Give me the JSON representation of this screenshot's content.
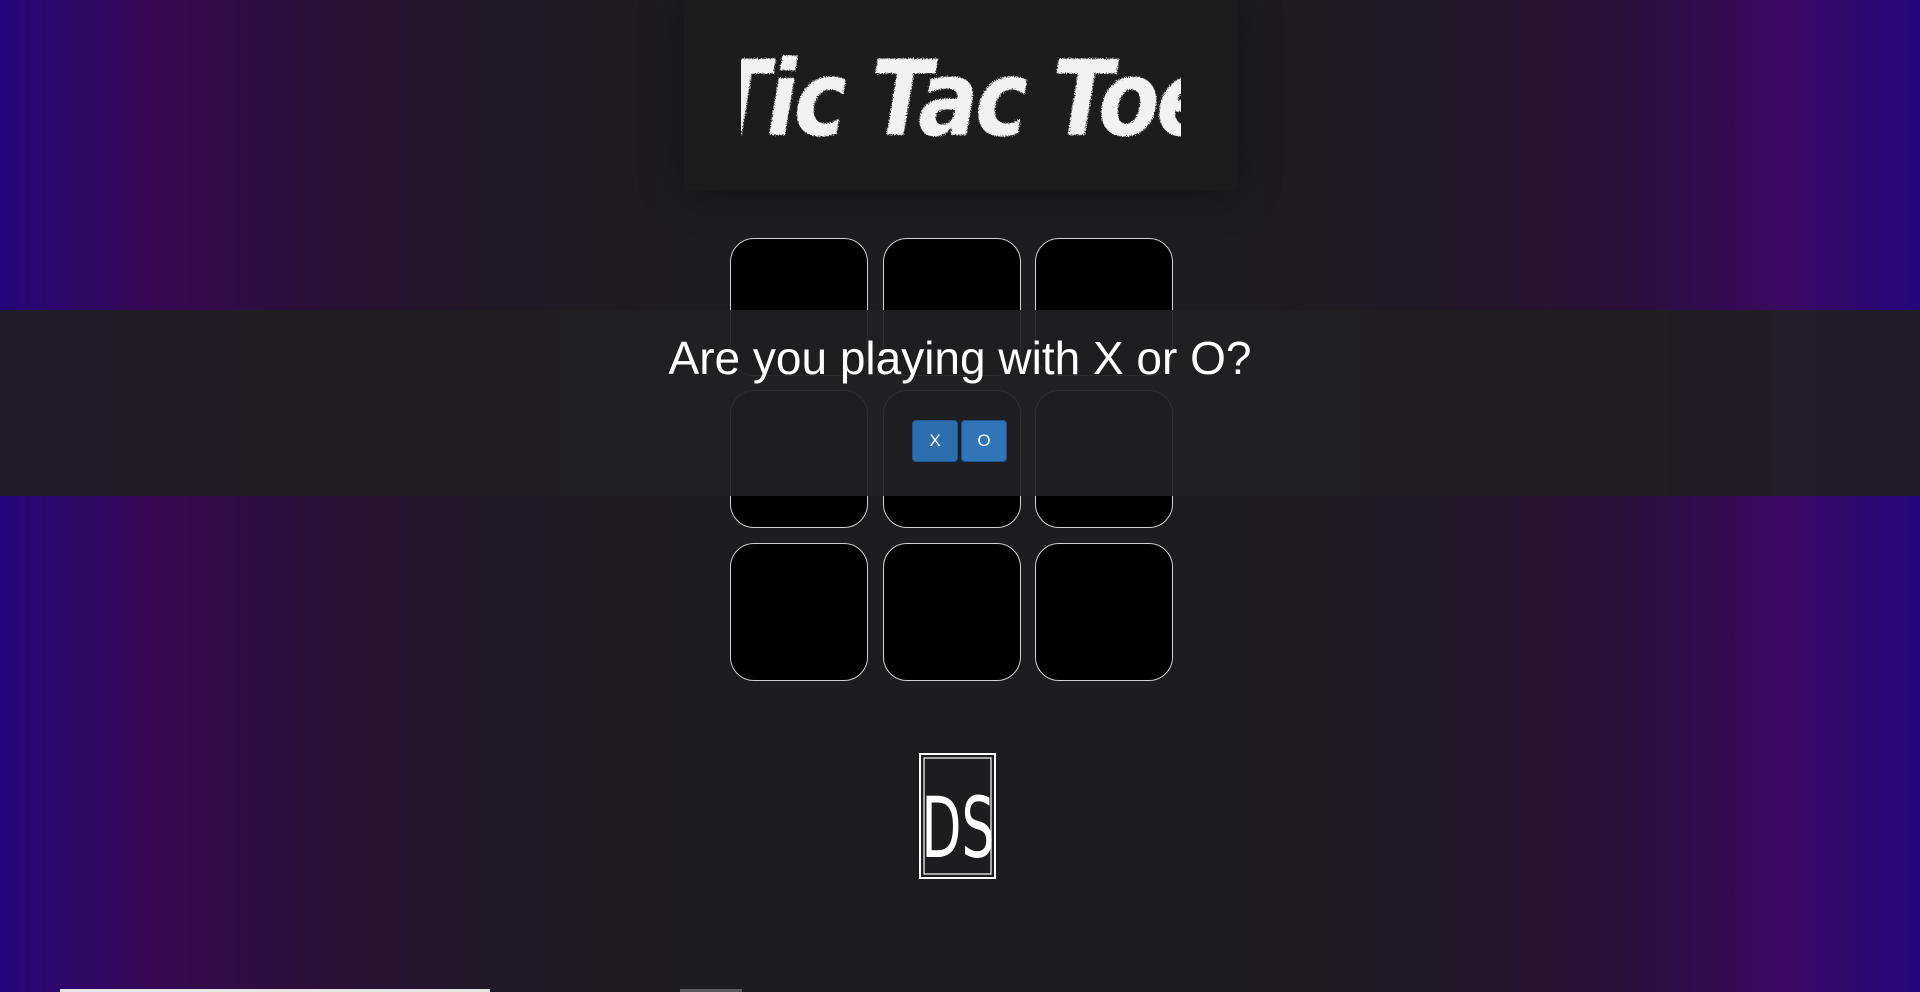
{
  "game": {
    "title": "Tic Tac Toe",
    "board_cells": [
      "",
      "",
      "",
      "",
      "",
      "",
      "",
      "",
      ""
    ]
  },
  "dialog": {
    "question": "Are you playing with X or O?",
    "choice_x": "X",
    "choice_o": "O"
  },
  "footer": {
    "logo_text": "DS"
  },
  "colors": {
    "accent_button": "#2c6fae",
    "cell_background": "#000000",
    "cell_border": "#cfcfcf"
  }
}
